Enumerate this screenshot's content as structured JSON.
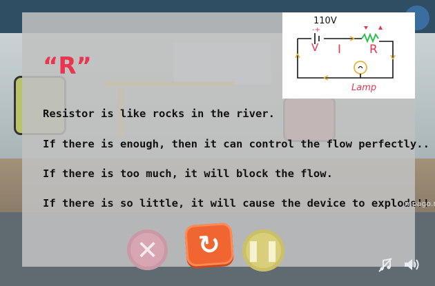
{
  "dialog": {
    "title": "“R”",
    "lines": [
      "Resistor is like rocks in the river.",
      "If there is enough, then it can control the flow perfectly..",
      "If there is too much, it will block the flow.",
      "If there is so little, it will cause the device to explode!!"
    ]
  },
  "diagram": {
    "voltage": "110V",
    "plus_minus": "-+",
    "label_v": "V",
    "label_i": "I",
    "label_r": "R",
    "label_lamp": "Lamp",
    "colors": {
      "wire": "#111111",
      "red": "#e8364f",
      "green": "#2bbf4f",
      "arrow": "#e8b23c"
    }
  },
  "controls": {
    "close_glyph": "✕",
    "replay_glyph": "↻",
    "pause_glyph": "❚❚"
  },
  "watermark": "mpago.net",
  "icons": {
    "music": "music-off-icon",
    "sound": "speaker-icon",
    "settings": "gear-icon"
  }
}
